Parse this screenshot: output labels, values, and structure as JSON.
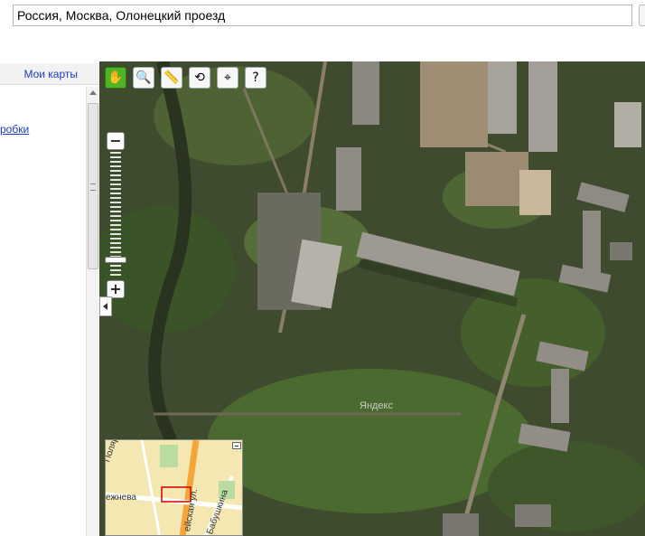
{
  "search": {
    "value": "Россия, Москва, Олонецкий проезд"
  },
  "sidebar": {
    "header_link": "Мои карты",
    "link_fragment": "робки"
  },
  "map": {
    "watermark": "Яндекс",
    "layer": "satellite",
    "toolbar": [
      {
        "name": "hand-tool",
        "icon": "hand-icon",
        "active": true
      },
      {
        "name": "magnifier-tool",
        "icon": "magnifier-icon",
        "active": false
      },
      {
        "name": "ruler-tool",
        "icon": "ruler-icon",
        "active": false
      },
      {
        "name": "route-tool",
        "icon": "route-icon",
        "active": false
      },
      {
        "name": "placemark-tool",
        "icon": "placemark-icon",
        "active": false
      },
      {
        "name": "info-tool",
        "icon": "cursor-question-icon",
        "active": false
      }
    ],
    "zoom": {
      "plus": "+",
      "minus": "−",
      "level_fraction": 0.15
    }
  },
  "minimap": {
    "labels": [
      "Полярная ул.",
      "ежнева",
      "ейская ул.",
      "Бабушкина"
    ]
  }
}
